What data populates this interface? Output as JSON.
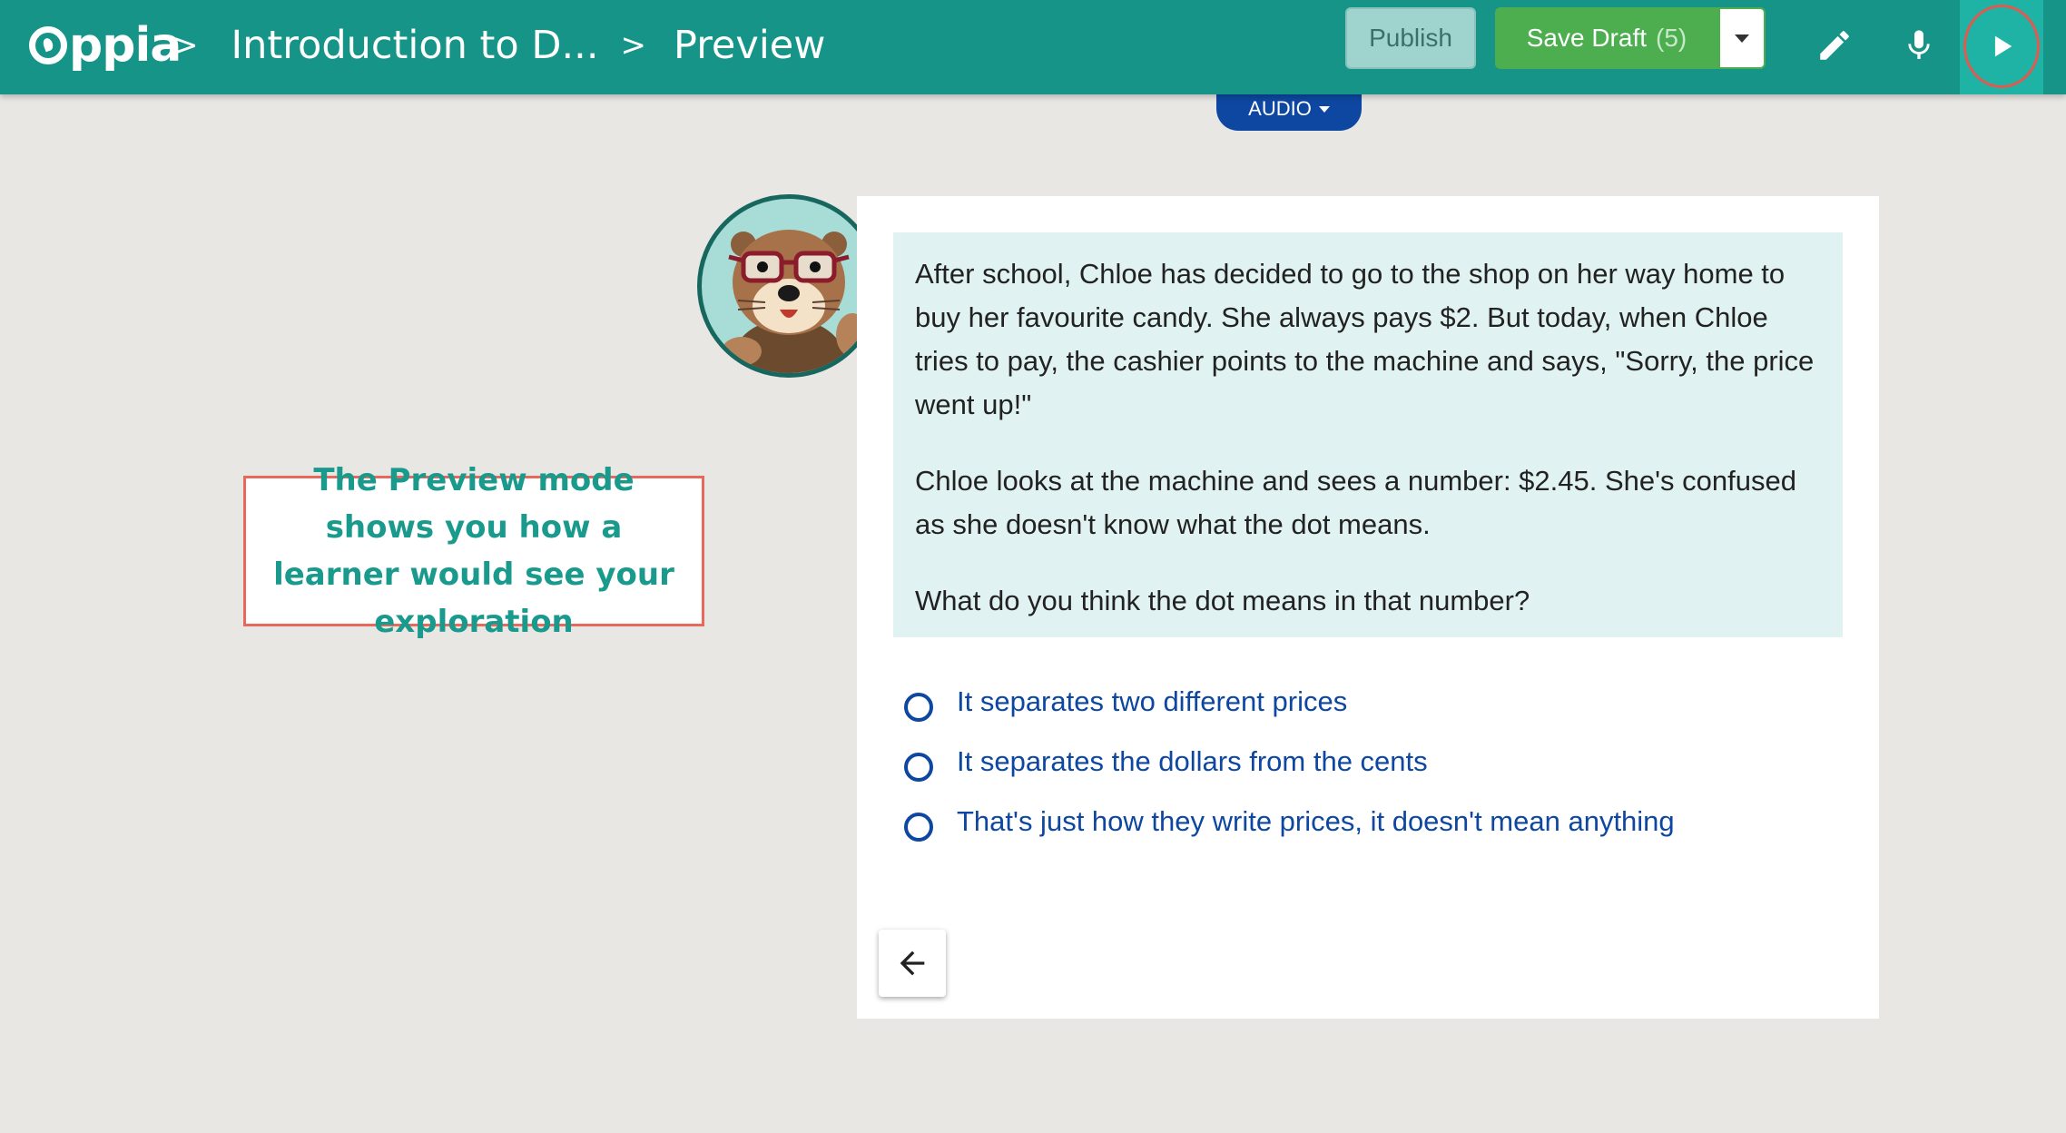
{
  "header": {
    "logo_text": "ppia",
    "breadcrumb_sep_1": ">",
    "exploration_title": "Introduction to D...",
    "breadcrumb_sep_2": ">",
    "current_page": "Preview",
    "publish_label": "Publish",
    "save_draft_label": "Save Draft",
    "save_draft_count": "(5)",
    "icons": [
      "chevron-down-icon",
      "pencil-icon",
      "microphone-icon",
      "play-icon"
    ]
  },
  "audio": {
    "label": "AUDIO"
  },
  "callout": {
    "text": "The Preview mode shows you how a learner would see your exploration"
  },
  "card": {
    "paragraphs": [
      "After school, Chloe has decided to go to the shop on her way home to buy her favourite candy. She always pays $2. But today, when Chloe tries to pay, the cashier points to the machine and says, \"Sorry, the price went up!\"",
      "Chloe looks at the machine and sees a number: $2.45. She's confused as she doesn't know what the dot means.",
      "What do you think the dot means in that number?"
    ],
    "choices": [
      "It separates two different prices",
      "It separates the dollars from the cents",
      "That's just how they write prices, it doesn't mean anything"
    ],
    "back_icon": "arrow-left-icon"
  },
  "colors": {
    "header_bg": "#169488",
    "publish_bg": "#9fd4ce",
    "save_bg": "#4cae4f",
    "audio_bg": "#0d47a1",
    "prompt_bg": "#e0f2f1",
    "choice_text": "#0d47a1",
    "callout_border": "#e8695c",
    "callout_text": "#1a9a8c",
    "page_bg": "#e8e7e4"
  }
}
